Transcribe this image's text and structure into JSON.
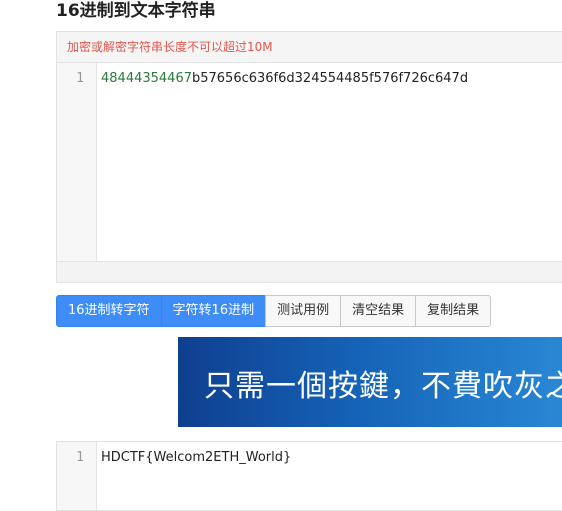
{
  "page": {
    "title": "16进制到文本字符串"
  },
  "input": {
    "warning": "加密或解密字符串长度不可以超过10M",
    "line_number": "1",
    "hex_highlight": "48444354467",
    "hex_rest": "b57656c636f6d324554485f576f726c647d"
  },
  "buttons": {
    "hex_to_str": "16进制转字符",
    "str_to_hex": "字符转16进制",
    "test_case": "测试用例",
    "clear": "清空结果",
    "copy": "复制结果"
  },
  "banner": {
    "text": "只需一個按鍵，不費吹灰之力"
  },
  "output": {
    "line_number": "1",
    "value": "HDCTF{Welcom2ETH_World}"
  },
  "colors": {
    "primary_button": "#3d8cf7",
    "warning_text": "#e2564c",
    "hex_number": "#2a7a3a",
    "banner_start": "#0f3f8f",
    "banner_end": "#2a8ad6"
  }
}
